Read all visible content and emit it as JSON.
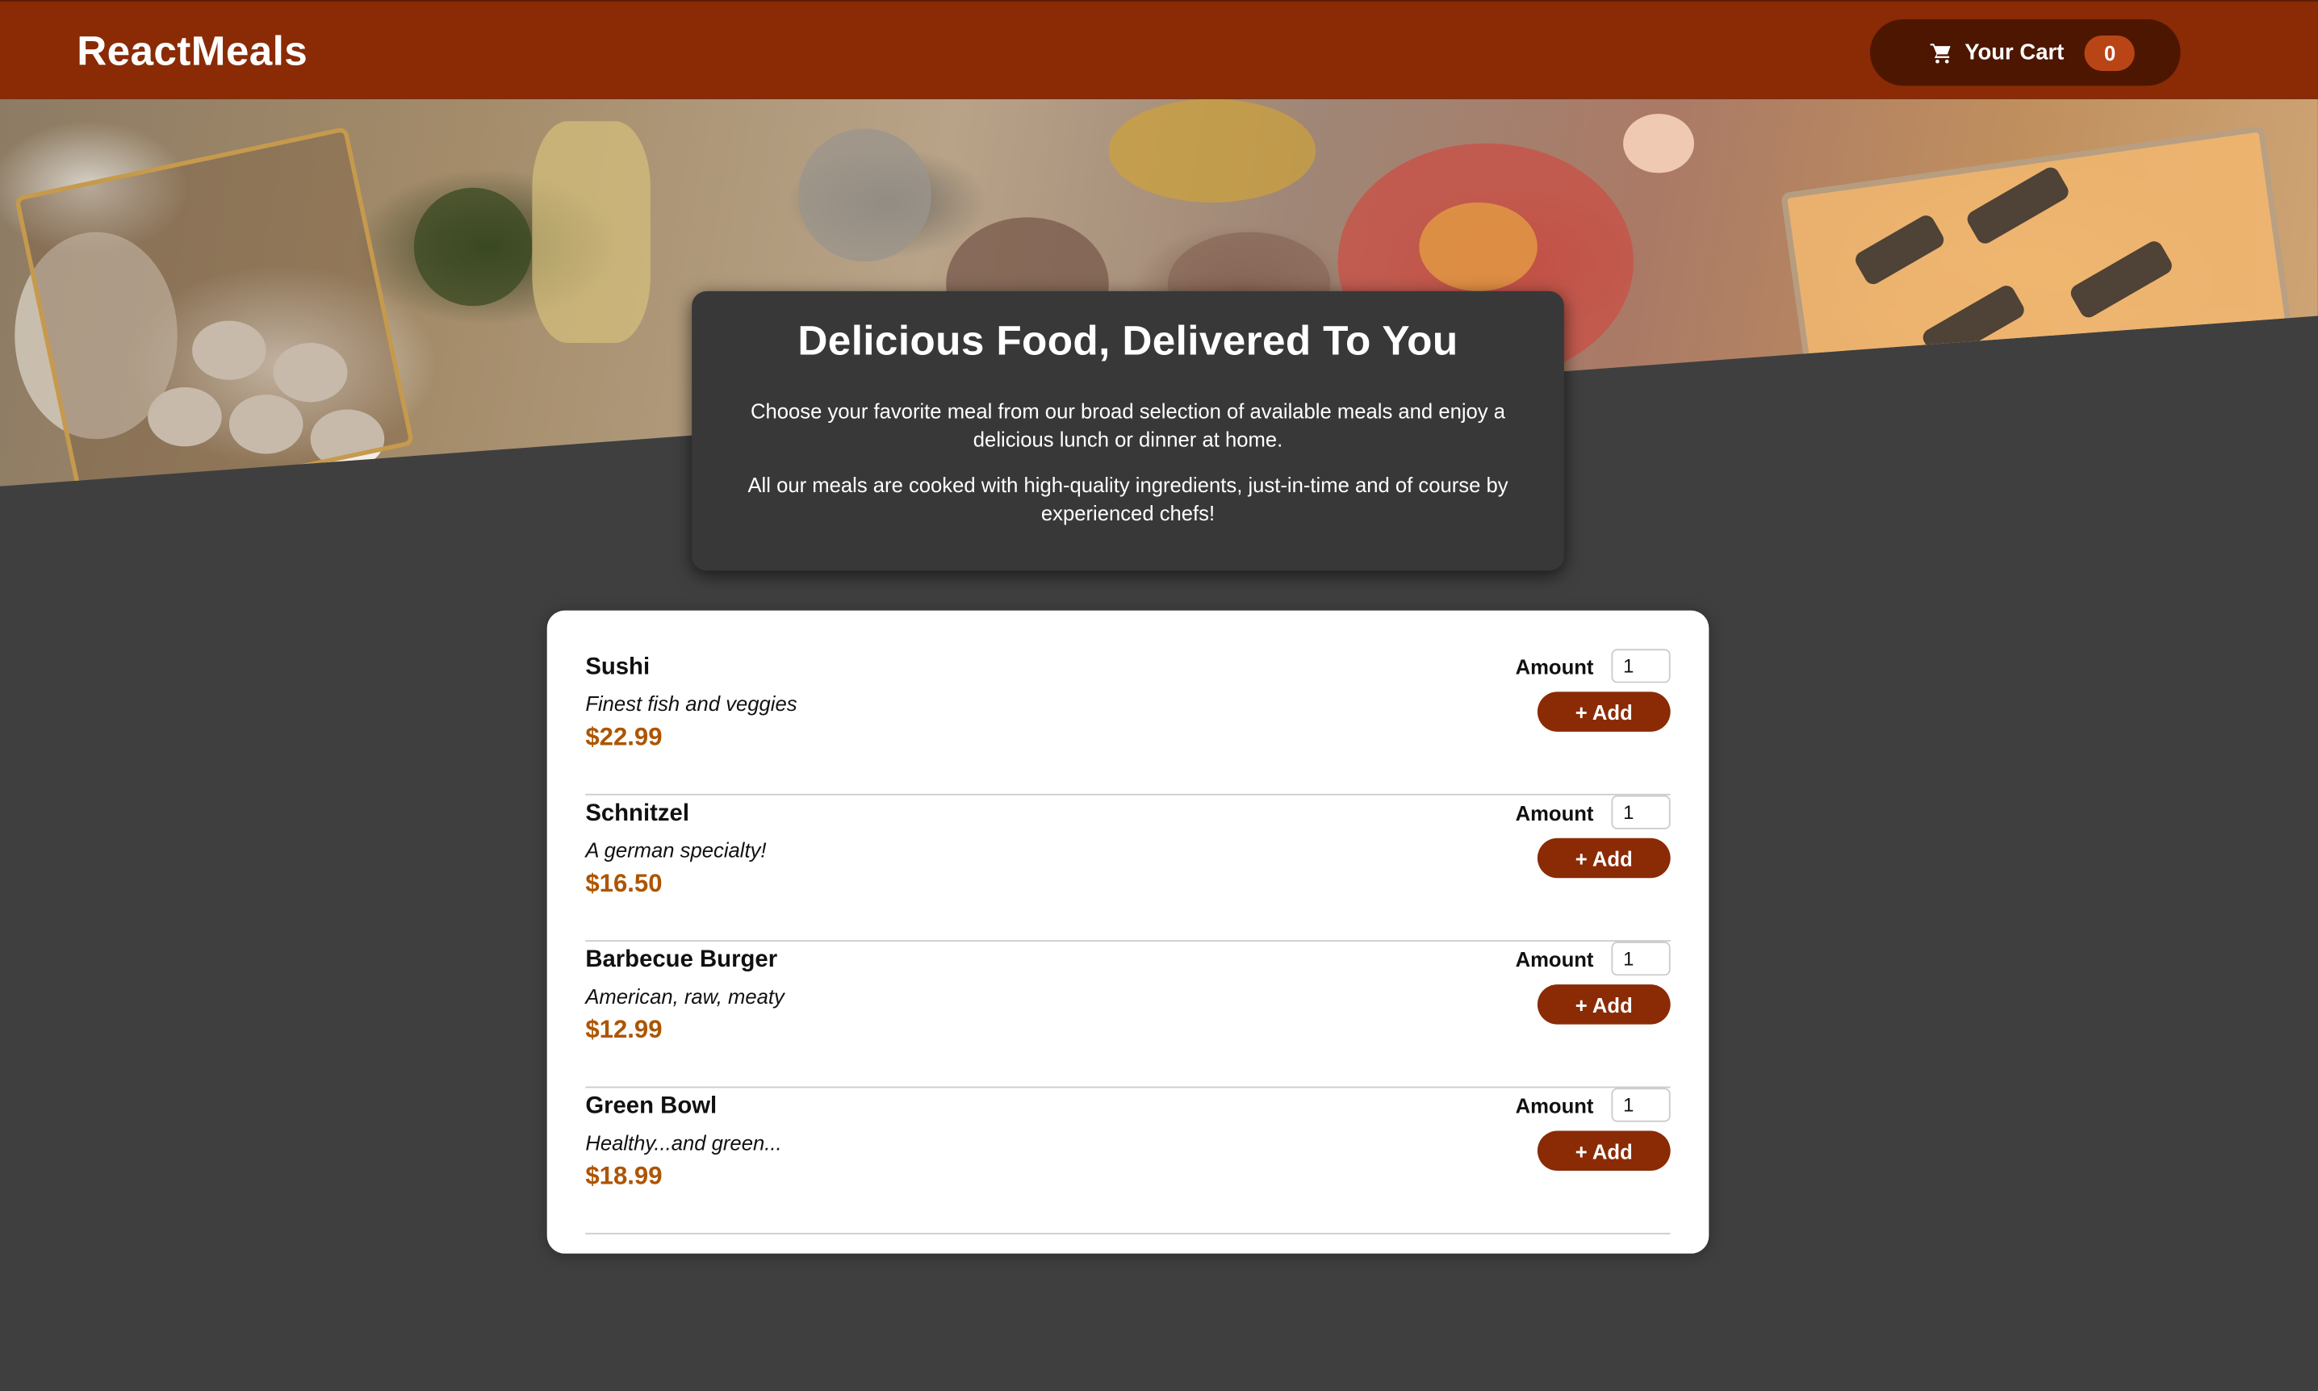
{
  "header": {
    "logo": "ReactMeals",
    "cart_label": "Your Cart",
    "cart_count": "0"
  },
  "summary": {
    "title": "Delicious Food, Delivered To You",
    "paragraph_1": "Choose your favorite meal from our broad selection of available meals and enjoy a delicious lunch or dinner at home.",
    "paragraph_2": "All our meals are cooked with high-quality ingredients, just-in-time and of course by experienced chefs!"
  },
  "meals": [
    {
      "name": "Sushi",
      "description": "Finest fish and veggies",
      "price": "$22.99",
      "amount_label": "Amount",
      "amount": "1",
      "add_label": "+ Add"
    },
    {
      "name": "Schnitzel",
      "description": "A german specialty!",
      "price": "$16.50",
      "amount_label": "Amount",
      "amount": "1",
      "add_label": "+ Add"
    },
    {
      "name": "Barbecue Burger",
      "description": "American, raw, meaty",
      "price": "$12.99",
      "amount_label": "Amount",
      "amount": "1",
      "add_label": "+ Add"
    },
    {
      "name": "Green Bowl",
      "description": "Healthy...and green...",
      "price": "$18.99",
      "amount_label": "Amount",
      "amount": "1",
      "add_label": "+ Add"
    }
  ],
  "colors": {
    "header": "#8a2b06",
    "cart_button": "#4d1601",
    "cart_badge": "#b94517",
    "background": "#3f3f3f",
    "price": "#ad5502",
    "add_button": "#8a2b06"
  },
  "icons": {
    "cart": "cart-icon",
    "hero": "hero-image"
  }
}
